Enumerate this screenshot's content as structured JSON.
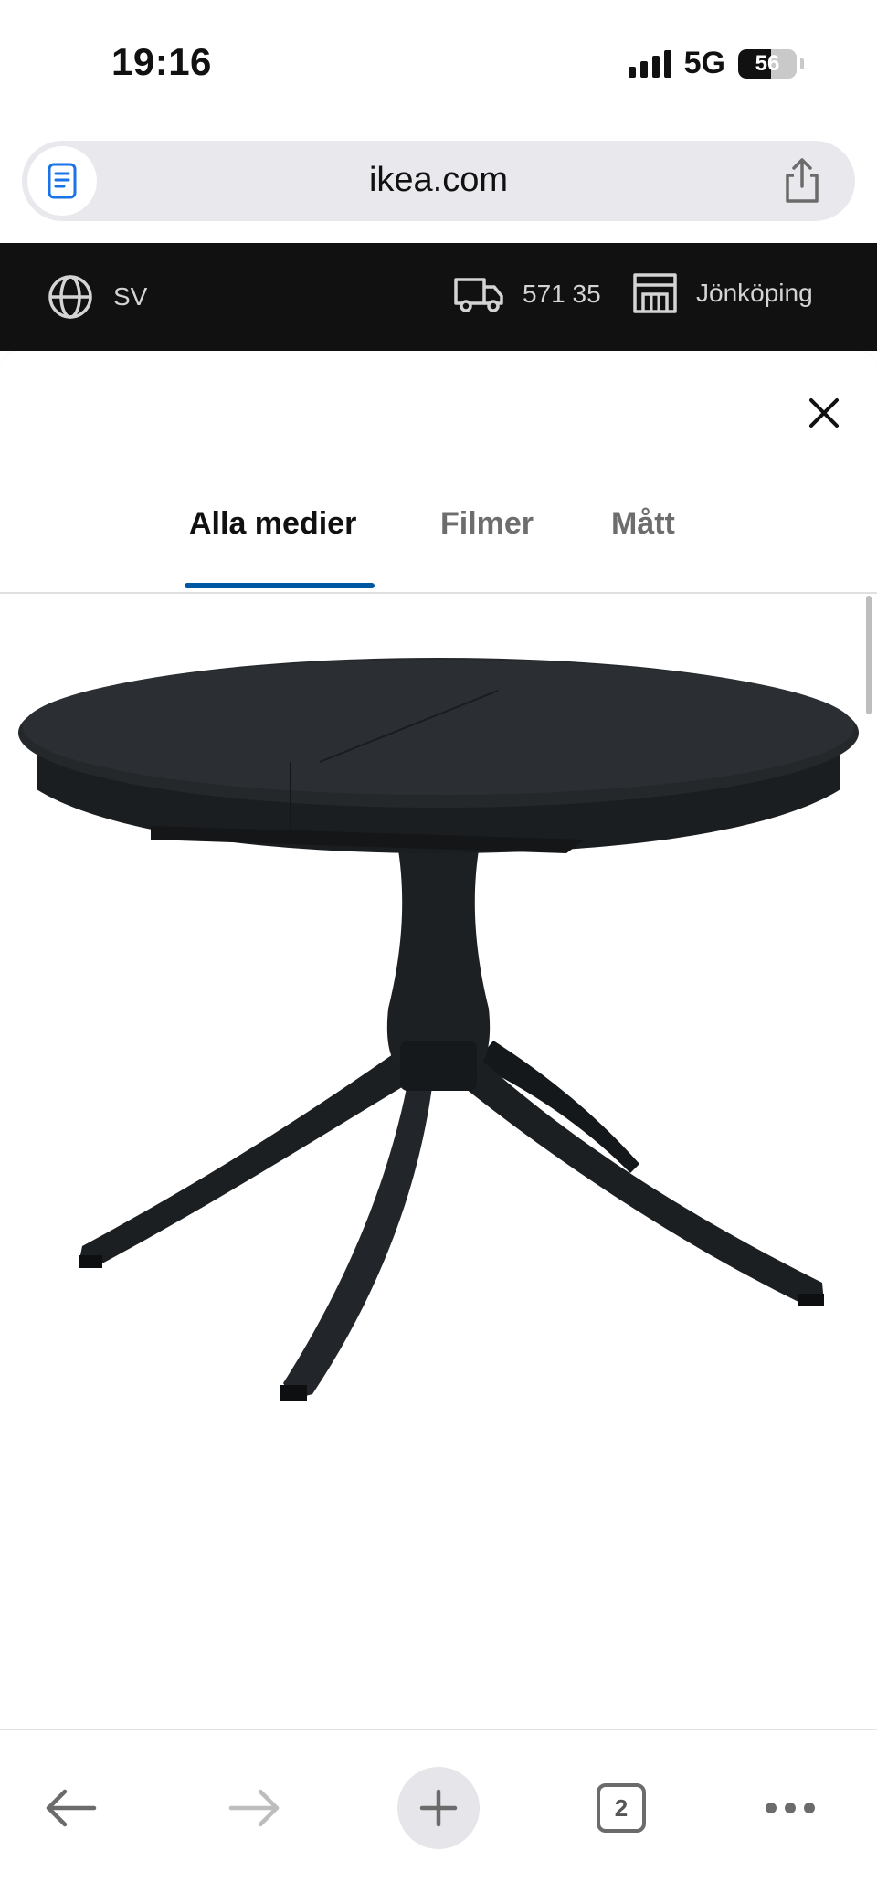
{
  "status_bar": {
    "time": "19:16",
    "network": "5G",
    "battery": "56",
    "battery_level_percent": 56
  },
  "browser": {
    "url": "ikea.com",
    "page_icon": "document-icon",
    "share_icon": "share-icon"
  },
  "site_header": {
    "language": "SV",
    "postcode": "571 35",
    "store": "Jönköping",
    "colors": {
      "background": "#111111",
      "text": "#d4d4d4"
    }
  },
  "modal": {
    "close_icon": "close-icon",
    "tabs": [
      {
        "label": "Alla medier",
        "active": true
      },
      {
        "label": "Filmer",
        "active": false
      },
      {
        "label": "Mått",
        "active": false
      }
    ],
    "accent_color": "#0058a3",
    "image_subject": "black round extendable pedestal table"
  },
  "toolbar": {
    "tabs_count": "2",
    "icons": [
      "back-arrow-icon",
      "forward-arrow-icon",
      "plus-icon",
      "tabs-icon",
      "more-icon"
    ]
  }
}
